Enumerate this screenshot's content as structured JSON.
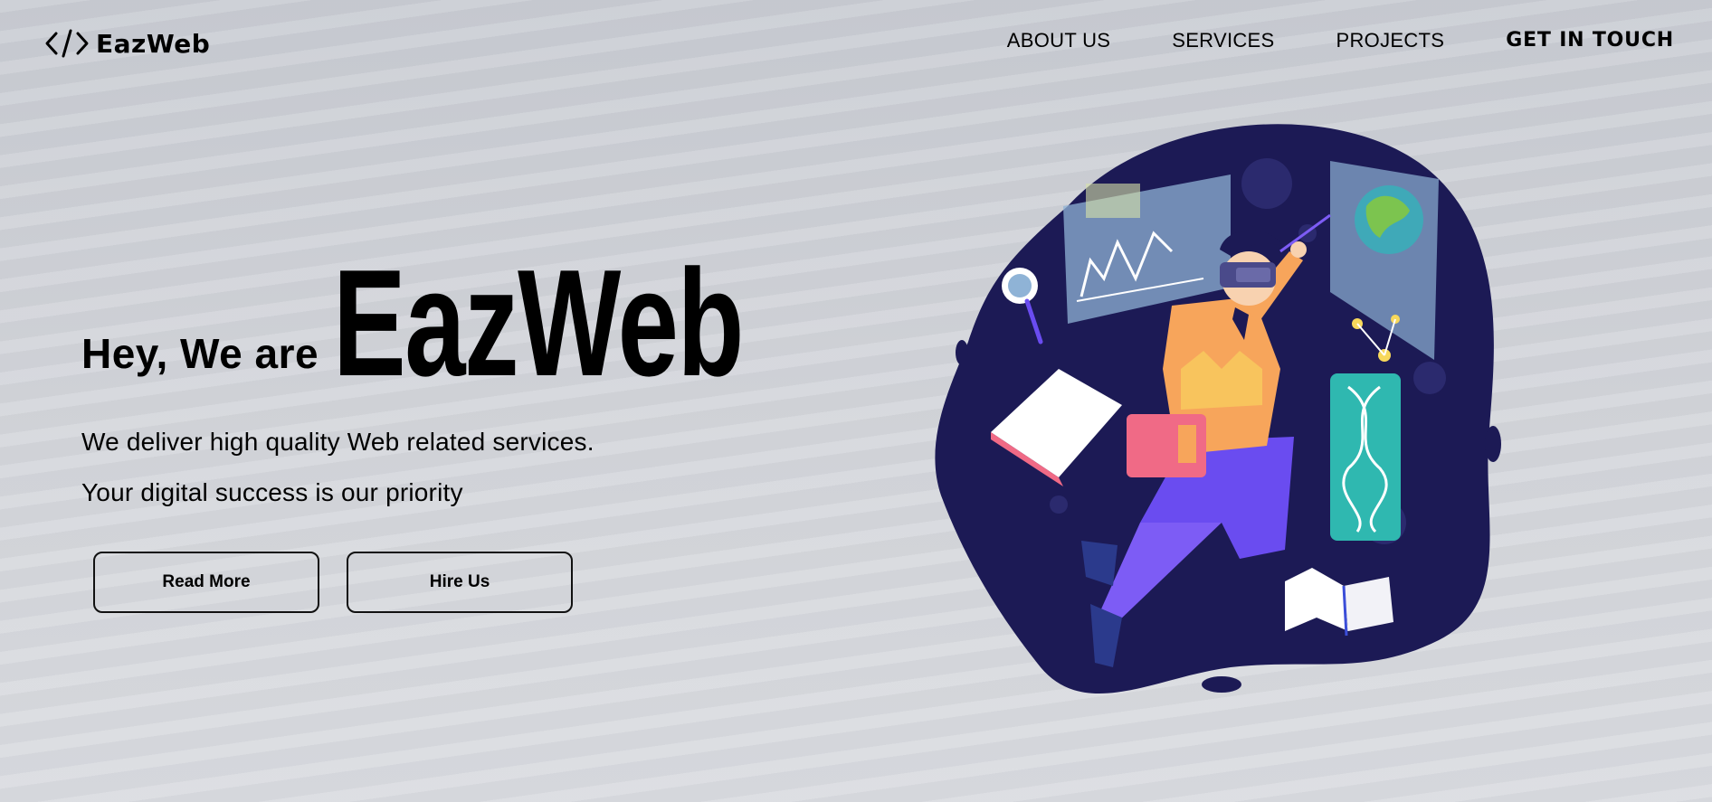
{
  "brand": {
    "name": "EazWeb",
    "logo_icon": "code-brackets-icon"
  },
  "nav": {
    "items": [
      {
        "label": "ABOUT US"
      },
      {
        "label": "SERVICES"
      },
      {
        "label": "PROJECTS"
      }
    ],
    "cta": "GET IN TOUCH"
  },
  "hero": {
    "prefix": "Hey, We are",
    "brand": "EazWeb",
    "line1": "We deliver high quality Web related services.",
    "line2": "Your digital success is our priority",
    "buttons": {
      "read_more": "Read More",
      "hire_us": "Hire Us"
    },
    "illustration_icon": "vr-student-illustration"
  },
  "colors": {
    "blob": "#1c1a55",
    "accent_orange": "#f7a55b",
    "accent_purple": "#6a4cf0",
    "accent_teal": "#35c9b8"
  }
}
